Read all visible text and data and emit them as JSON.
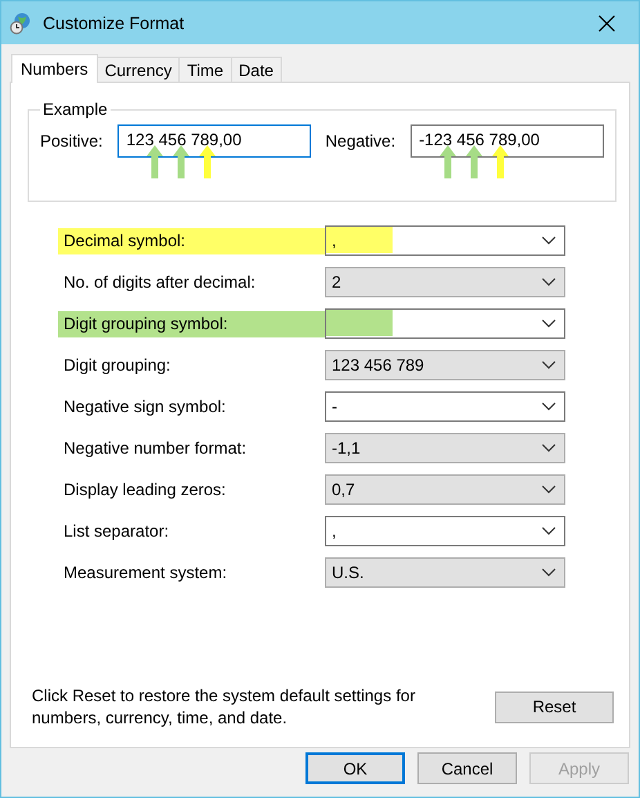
{
  "window": {
    "title": "Customize Format"
  },
  "tabs": [
    {
      "label": "Numbers",
      "selected": true
    },
    {
      "label": "Currency",
      "selected": false
    },
    {
      "label": "Time",
      "selected": false
    },
    {
      "label": "Date",
      "selected": false
    }
  ],
  "example": {
    "title": "Example",
    "fields": [
      {
        "label": "Positive:",
        "value": "123 456 789,00",
        "focused": true,
        "arrows": [
          {
            "color": "#a6dc86"
          },
          {
            "color": "#a6dc86"
          },
          {
            "color": "#ffff3c"
          }
        ]
      },
      {
        "label": "Negative:",
        "value": "-123 456 789,00",
        "focused": false,
        "arrows": [
          {
            "color": "#a6dc86"
          },
          {
            "color": "#a6dc86"
          },
          {
            "color": "#ffff3c"
          }
        ]
      }
    ]
  },
  "settings": [
    {
      "label": "Decimal symbol:",
      "value": ",",
      "kind": "editable",
      "color": "#ffff66"
    },
    {
      "label": "No. of digits after decimal:",
      "value": "2",
      "kind": "list"
    },
    {
      "label": "Digit grouping symbol:",
      "kind": "editable",
      "color": "#b3e28c"
    },
    {
      "label": "Digit grouping:",
      "value": "123 456 789",
      "kind": "list"
    },
    {
      "label": "Negative sign symbol:",
      "value": "-",
      "kind": "editable"
    },
    {
      "label": "Negative number format:",
      "value": "-1,1",
      "kind": "list"
    },
    {
      "label": "Display leading zeros:",
      "value": "0,7",
      "kind": "list"
    },
    {
      "label": "List separator:",
      "value": ",",
      "kind": "editable"
    },
    {
      "label": "Measurement system:",
      "value": "U.S.",
      "kind": "list"
    }
  ],
  "reset_note": "Click Reset to restore the system default settings for numbers, currency, time, and date.",
  "reset_button": "Reset",
  "buttons": [
    {
      "label": "OK",
      "default": true,
      "disabled": false
    },
    {
      "label": "Cancel",
      "default": false,
      "disabled": false
    },
    {
      "label": "Apply",
      "default": false,
      "disabled": true
    }
  ]
}
